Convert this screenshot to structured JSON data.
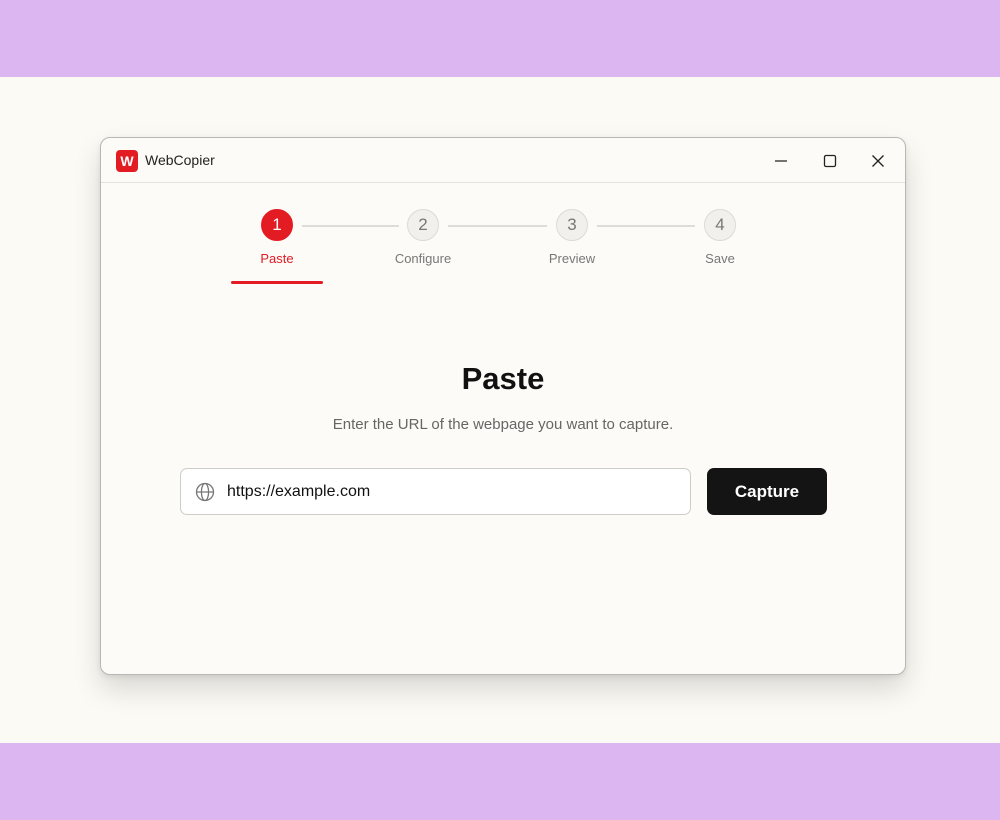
{
  "colors": {
    "accent": "#e31b23",
    "band": "#dbb6f0",
    "primary_button": "#141414"
  },
  "app": {
    "logo_letter": "W",
    "title": "WebCopier"
  },
  "window_controls": {
    "minimize": "minimize-icon",
    "maximize": "maximize-icon",
    "close": "close-icon"
  },
  "steps": [
    {
      "number": "1",
      "label": "Paste",
      "active": true
    },
    {
      "number": "2",
      "label": "Configure",
      "active": false
    },
    {
      "number": "3",
      "label": "Preview",
      "active": false
    },
    {
      "number": "4",
      "label": "Save",
      "active": false
    }
  ],
  "main": {
    "title": "Paste",
    "subtitle": "Enter the URL of the webpage you want to capture.",
    "url_value": "https://example.com",
    "url_icon": "globe-icon",
    "capture_label": "Capture"
  }
}
